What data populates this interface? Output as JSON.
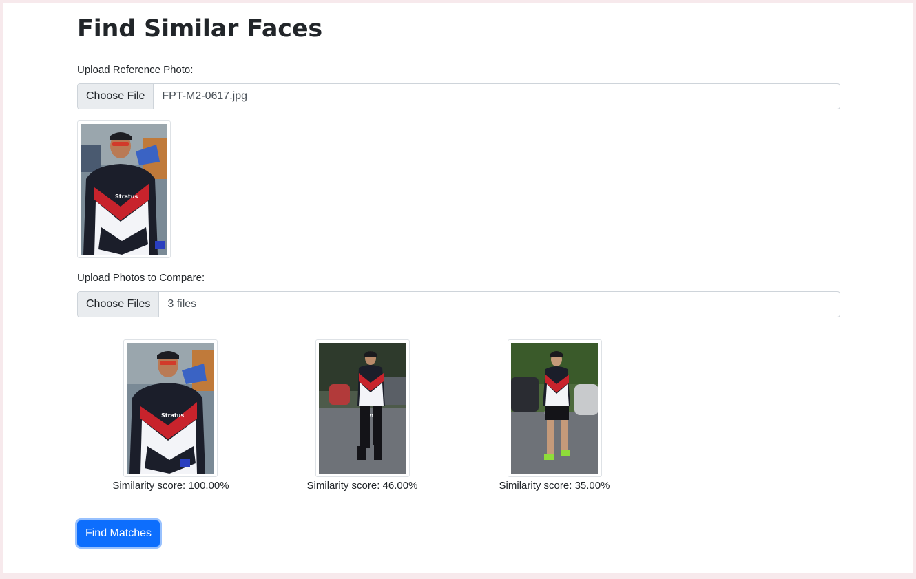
{
  "title": "Find Similar Faces",
  "reference": {
    "label": "Upload Reference Photo:",
    "button_label": "Choose File",
    "file_name": "FPT-M2-0617.jpg"
  },
  "compare": {
    "label": "Upload Photos to Compare:",
    "button_label": "Choose Files",
    "file_summary": "3 files"
  },
  "results": [
    {
      "score_text": "Similarity score: 100.00%"
    },
    {
      "score_text": "Similarity score: 46.00%"
    },
    {
      "score_text": "Similarity score: 35.00%"
    }
  ],
  "submit_label": "Find Matches",
  "colors": {
    "primary": "#0d6efd",
    "page_border": "#f7e9ec"
  }
}
